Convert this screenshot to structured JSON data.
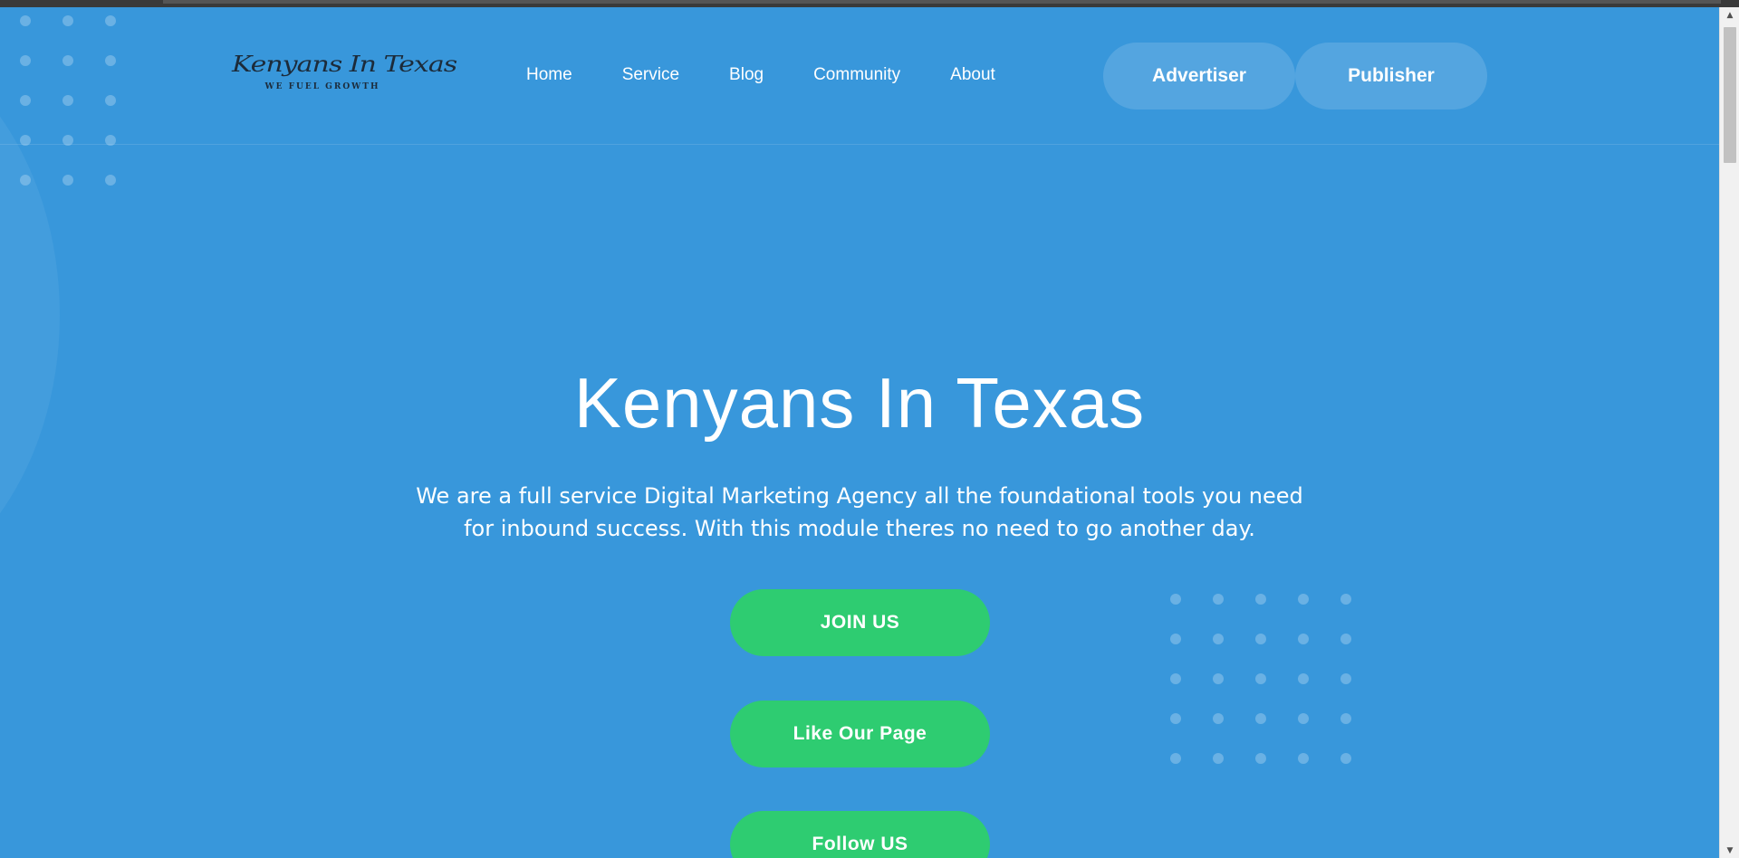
{
  "brand": {
    "logo_script": "Kenyans In Texas",
    "logo_tagline": "WE FUEL GROWTH"
  },
  "nav": {
    "items": [
      {
        "label": "Home"
      },
      {
        "label": "Service"
      },
      {
        "label": "Blog"
      },
      {
        "label": "Community"
      },
      {
        "label": "About"
      }
    ],
    "advertiser_label": "Advertiser",
    "publisher_label": "Publisher"
  },
  "hero": {
    "title": "Kenyans In Texas",
    "description": "We are a full service Digital Marketing Agency all the foundational tools you need for inbound success. With this module theres no need to go another day.",
    "join_label": "JOIN US",
    "like_label": "Like Our Page",
    "follow_label": "Follow US"
  },
  "colors": {
    "background": "#3897db",
    "button_green": "#2ecc71",
    "logo_ink": "#1c2b3a"
  },
  "scrollbar": {
    "up_icon": "scroll-up-arrow-icon",
    "down_icon": "scroll-down-arrow-icon"
  }
}
